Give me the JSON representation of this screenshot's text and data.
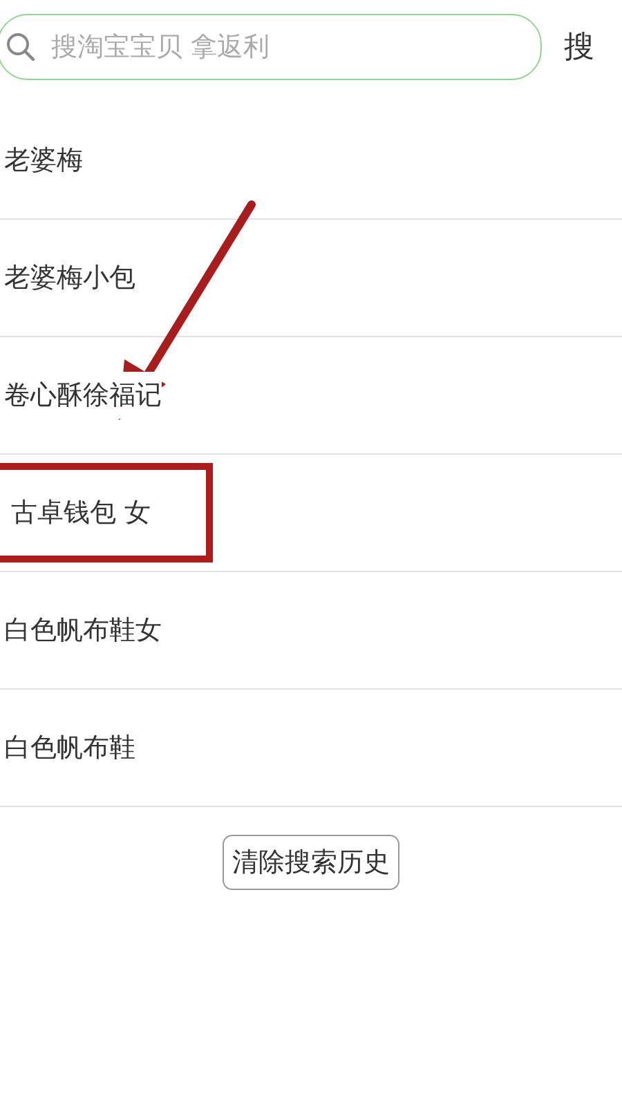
{
  "search": {
    "placeholder": "搜淘宝宝贝 拿返利",
    "button": "搜"
  },
  "history": [
    {
      "text": "老婆梅",
      "highlighted": false
    },
    {
      "text": "老婆梅小包",
      "highlighted": false
    },
    {
      "text": "卷心酥徐福记",
      "highlighted": false
    },
    {
      "text": "古卓钱包 女",
      "highlighted": true
    },
    {
      "text": "白色帆布鞋女",
      "highlighted": false
    },
    {
      "text": "白色帆布鞋",
      "highlighted": false
    }
  ],
  "clear_button": "清除搜索历史"
}
